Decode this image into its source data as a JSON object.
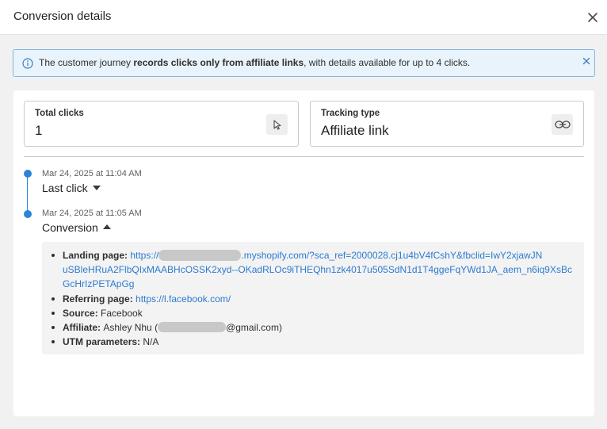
{
  "modal": {
    "title": "Conversion details"
  },
  "banner": {
    "text_prefix": "The customer journey ",
    "text_bold": "records clicks only from affiliate links",
    "text_suffix": ", with details available for up to 4 clicks."
  },
  "stats": {
    "total_clicks": {
      "label": "Total clicks",
      "value": "1",
      "icon": "cursor-icon"
    },
    "tracking_type": {
      "label": "Tracking type",
      "value": "Affiliate link",
      "icon": "link-icon"
    }
  },
  "timeline": [
    {
      "date": "Mar 24, 2025 at 11:04 AM",
      "title": "Last click",
      "expanded": false
    },
    {
      "date": "Mar 24, 2025 at 11:05 AM",
      "title": "Conversion",
      "expanded": true
    }
  ],
  "details": {
    "landing_page": {
      "label": "Landing page",
      "url_prefix": "https://",
      "url_line1_rest": ".myshopify.com/?sca_ref=2000028.cj1u4bV4fCshY&fbclid=IwY2xjawJN",
      "url_line2": "uSBleHRuA2FlbQIxMAABHcOSSK2xyd--OKadRLOc9iTHEQhn1zk4017u505SdN1d1T4ggeFqYWd1JA_aem_n6iq9XsBc",
      "url_line3": "GcHrIzPETApGg"
    },
    "referring_page": {
      "label": "Referring page",
      "url": "https://l.facebook.com/"
    },
    "source": {
      "label": "Source",
      "value": "Facebook"
    },
    "affiliate": {
      "label": "Affiliate",
      "name": "Ashley Nhu",
      "email_suffix": "@gmail.com"
    },
    "utm": {
      "label": "UTM parameters:",
      "value": "N/A"
    }
  },
  "colors": {
    "accent": "#2b84db",
    "link": "#2b7bd0",
    "banner_bg": "#e8f3fb",
    "banner_border": "#84b6e0"
  }
}
